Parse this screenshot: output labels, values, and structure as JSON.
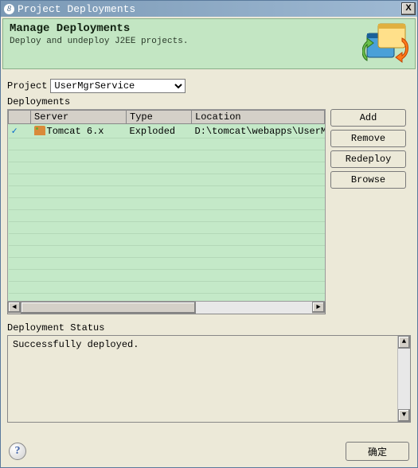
{
  "titlebar": {
    "title": "Project Deployments"
  },
  "banner": {
    "heading": "Manage Deployments",
    "subtext": "Deploy and undeploy J2EE projects."
  },
  "project": {
    "label": "Project",
    "selected": "UserMgrService",
    "options": [
      "UserMgrService"
    ]
  },
  "deployments": {
    "label": "Deployments",
    "columns": {
      "server": "Server",
      "type": "Type",
      "location": "Location"
    },
    "rows": [
      {
        "checked": true,
        "server": "Tomcat  6.x",
        "type": "Exploded",
        "location": "D:\\tomcat\\webapps\\UserMgrSe"
      }
    ]
  },
  "buttons": {
    "add": "Add",
    "remove": "Remove",
    "redeploy": "Redeploy",
    "browse": "Browse"
  },
  "status": {
    "label": "Deployment Status",
    "text": "Successfully deployed."
  },
  "footer": {
    "help_icon": "?",
    "ok": "确定"
  }
}
